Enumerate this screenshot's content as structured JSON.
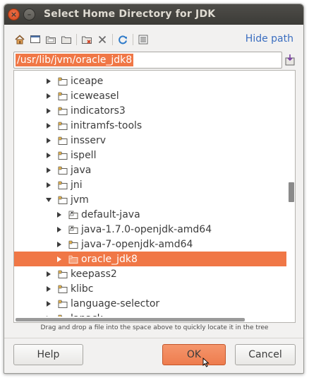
{
  "window": {
    "title": "Select Home Directory for JDK",
    "close_glyph": "×",
    "minimize_glyph": "–"
  },
  "toolbar": {
    "icons": [
      "home-icon",
      "desktop-icon",
      "new-folder-icon",
      "folder-icon",
      "delete-folder-icon",
      "delete-icon",
      "refresh-icon",
      "show-hidden-icon"
    ],
    "hide_path_label": "Hide path"
  },
  "path": {
    "value": "/usr/lib/jvm/oracle_jdk8"
  },
  "tree": {
    "rows": [
      {
        "label": "iceape",
        "depth": 0,
        "expanded": false,
        "selected": false,
        "link": false
      },
      {
        "label": "iceweasel",
        "depth": 0,
        "expanded": false,
        "selected": false,
        "link": false
      },
      {
        "label": "indicators3",
        "depth": 0,
        "expanded": false,
        "selected": false,
        "link": false
      },
      {
        "label": "initramfs-tools",
        "depth": 0,
        "expanded": false,
        "selected": false,
        "link": false
      },
      {
        "label": "insserv",
        "depth": 0,
        "expanded": false,
        "selected": false,
        "link": false
      },
      {
        "label": "ispell",
        "depth": 0,
        "expanded": false,
        "selected": false,
        "link": false
      },
      {
        "label": "java",
        "depth": 0,
        "expanded": false,
        "selected": false,
        "link": false
      },
      {
        "label": "jni",
        "depth": 0,
        "expanded": false,
        "selected": false,
        "link": false
      },
      {
        "label": "jvm",
        "depth": 0,
        "expanded": true,
        "selected": false,
        "link": false
      },
      {
        "label": "default-java",
        "depth": 1,
        "expanded": false,
        "selected": false,
        "link": true
      },
      {
        "label": "java-1.7.0-openjdk-amd64",
        "depth": 1,
        "expanded": false,
        "selected": false,
        "link": true
      },
      {
        "label": "java-7-openjdk-amd64",
        "depth": 1,
        "expanded": false,
        "selected": false,
        "link": false
      },
      {
        "label": "oracle_jdk8",
        "depth": 1,
        "expanded": false,
        "selected": true,
        "link": false
      },
      {
        "label": "keepass2",
        "depth": 0,
        "expanded": false,
        "selected": false,
        "link": false
      },
      {
        "label": "klibc",
        "depth": 0,
        "expanded": false,
        "selected": false,
        "link": false
      },
      {
        "label": "language-selector",
        "depth": 0,
        "expanded": false,
        "selected": false,
        "link": false
      },
      {
        "label": "lapack",
        "depth": 0,
        "expanded": false,
        "selected": false,
        "link": false
      }
    ]
  },
  "hint": "Drag and drop a file into the space above to quickly locate it in the tree",
  "buttons": {
    "help": "Help",
    "ok": "OK",
    "cancel": "Cancel"
  },
  "colors": {
    "accent": "#f07746",
    "link": "#3b6ec0",
    "titlebar": "#3c3b37"
  }
}
